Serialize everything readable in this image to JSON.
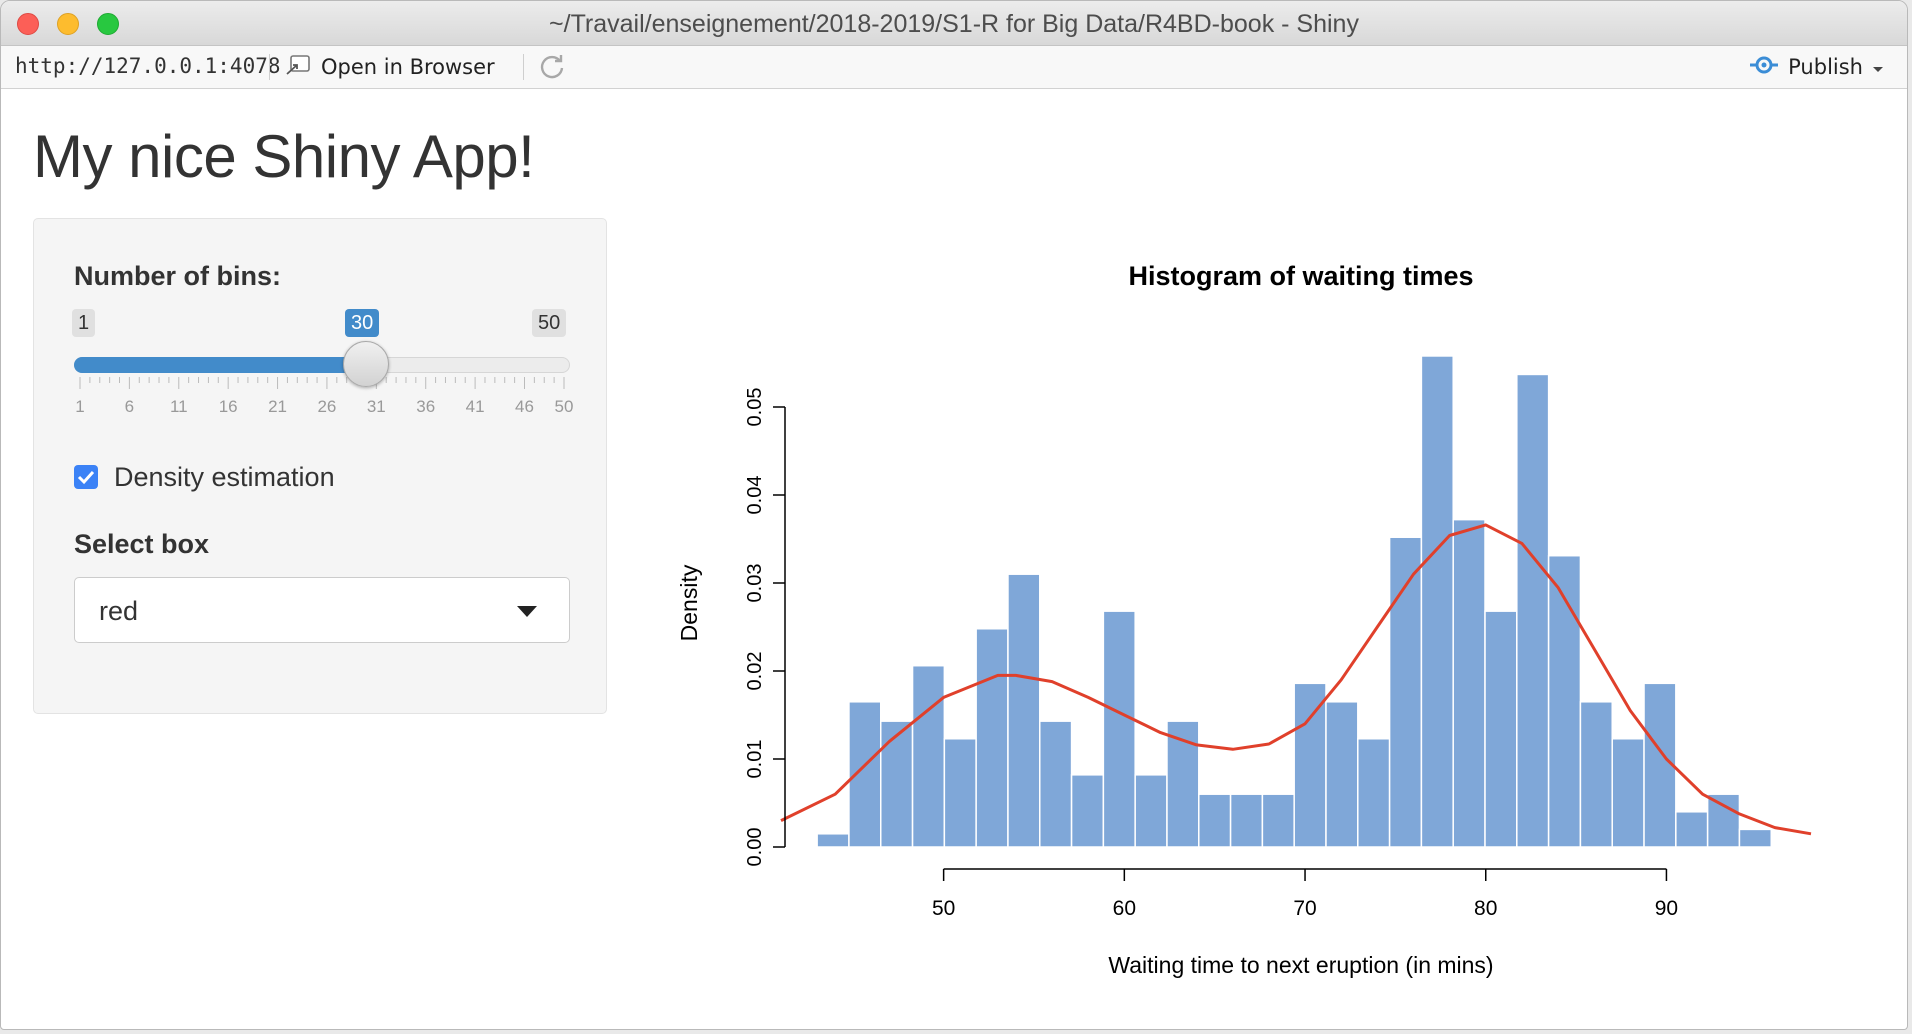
{
  "window": {
    "title": "~/Travail/enseignement/2018-2019/S1-R for Big Data/R4BD-book - Shiny"
  },
  "toolbar": {
    "url": "http://127.0.0.1:4078",
    "open_in_browser": "Open in Browser",
    "publish": "Publish"
  },
  "app": {
    "title": "My nice Shiny App!"
  },
  "sidebar": {
    "slider": {
      "label": "Number of bins:",
      "min": 1,
      "max": 50,
      "value": 30,
      "min_label": "1",
      "max_label": "50",
      "value_label": "30",
      "grid_labels": [
        "1",
        "6",
        "11",
        "16",
        "21",
        "26",
        "31",
        "36",
        "41",
        "46",
        "50"
      ]
    },
    "checkbox": {
      "label": "Density estimation",
      "checked": true
    },
    "select": {
      "label": "Select box",
      "value": "red"
    }
  },
  "colors": {
    "accent": "#428bca",
    "bars": "#7fa7d8",
    "density": "#e0402b",
    "checkbox": "#3b82f6"
  },
  "chart_data": {
    "type": "bar",
    "title": "Histogram of waiting times",
    "xlabel": "Waiting time to next eruption (in mins)",
    "ylabel": "Density",
    "xlim": [
      41,
      98
    ],
    "ylim": [
      0,
      0.05
    ],
    "x_ticks": [
      50,
      60,
      70,
      80,
      90
    ],
    "y_ticks": [
      0.0,
      0.01,
      0.02,
      0.03,
      0.04,
      0.05
    ],
    "y_tick_labels": [
      "0.00",
      "0.01",
      "0.02",
      "0.03",
      "0.04",
      "0.05"
    ],
    "bins": [
      {
        "start": 43.0,
        "end": 44.76,
        "density": 0.0015
      },
      {
        "start": 44.76,
        "end": 46.52,
        "density": 0.0165
      },
      {
        "start": 46.52,
        "end": 48.28,
        "density": 0.0143
      },
      {
        "start": 48.28,
        "end": 50.04,
        "density": 0.0206
      },
      {
        "start": 50.04,
        "end": 51.8,
        "density": 0.0123
      },
      {
        "start": 51.8,
        "end": 53.56,
        "density": 0.0248
      },
      {
        "start": 53.56,
        "end": 55.32,
        "density": 0.031
      },
      {
        "start": 55.32,
        "end": 57.08,
        "density": 0.0143
      },
      {
        "start": 57.08,
        "end": 58.84,
        "density": 0.0082
      },
      {
        "start": 58.84,
        "end": 60.6,
        "density": 0.0268
      },
      {
        "start": 60.6,
        "end": 62.36,
        "density": 0.0082
      },
      {
        "start": 62.36,
        "end": 64.12,
        "density": 0.0143
      },
      {
        "start": 64.12,
        "end": 65.88,
        "density": 0.006
      },
      {
        "start": 65.88,
        "end": 67.64,
        "density": 0.006
      },
      {
        "start": 67.64,
        "end": 69.4,
        "density": 0.006
      },
      {
        "start": 69.4,
        "end": 71.16,
        "density": 0.0186
      },
      {
        "start": 71.16,
        "end": 72.92,
        "density": 0.0165
      },
      {
        "start": 72.92,
        "end": 74.68,
        "density": 0.0123
      },
      {
        "start": 74.68,
        "end": 76.44,
        "density": 0.0352
      },
      {
        "start": 76.44,
        "end": 78.2,
        "density": 0.0558
      },
      {
        "start": 78.2,
        "end": 79.96,
        "density": 0.0372
      },
      {
        "start": 79.96,
        "end": 81.72,
        "density": 0.0268
      },
      {
        "start": 81.72,
        "end": 83.48,
        "density": 0.0537
      },
      {
        "start": 83.48,
        "end": 85.24,
        "density": 0.0331
      },
      {
        "start": 85.24,
        "end": 87.0,
        "density": 0.0165
      },
      {
        "start": 87.0,
        "end": 88.76,
        "density": 0.0123
      },
      {
        "start": 88.76,
        "end": 90.52,
        "density": 0.0186
      },
      {
        "start": 90.52,
        "end": 92.28,
        "density": 0.004
      },
      {
        "start": 92.28,
        "end": 94.04,
        "density": 0.006
      },
      {
        "start": 94.04,
        "end": 95.8,
        "density": 0.002
      }
    ],
    "density_curve": [
      [
        41,
        0.003
      ],
      [
        44,
        0.006
      ],
      [
        47,
        0.012
      ],
      [
        50,
        0.017
      ],
      [
        53,
        0.0195
      ],
      [
        54,
        0.0195
      ],
      [
        56,
        0.0188
      ],
      [
        58,
        0.017
      ],
      [
        60,
        0.015
      ],
      [
        62,
        0.013
      ],
      [
        64,
        0.0116
      ],
      [
        66,
        0.0111
      ],
      [
        68,
        0.0117
      ],
      [
        70,
        0.014
      ],
      [
        72,
        0.019
      ],
      [
        74,
        0.025
      ],
      [
        76,
        0.031
      ],
      [
        78,
        0.0354
      ],
      [
        80,
        0.0366
      ],
      [
        82,
        0.0345
      ],
      [
        84,
        0.0295
      ],
      [
        86,
        0.0225
      ],
      [
        88,
        0.0155
      ],
      [
        90,
        0.01
      ],
      [
        92,
        0.006
      ],
      [
        94,
        0.0038
      ],
      [
        96,
        0.0022
      ],
      [
        98,
        0.0015
      ]
    ]
  }
}
